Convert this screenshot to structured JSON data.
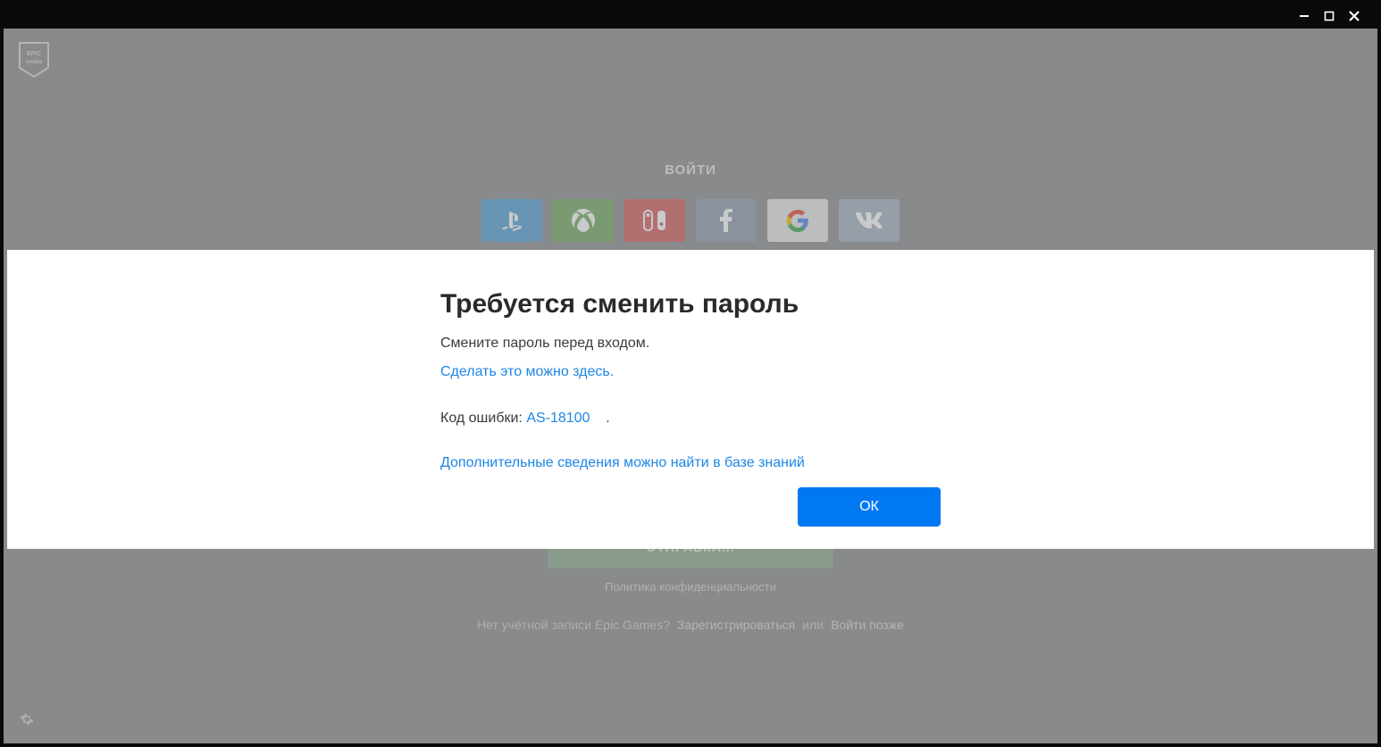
{
  "window": {
    "minimize": "−",
    "maximize": "☐",
    "close": "✕"
  },
  "login": {
    "title": "ВОЙТИ",
    "submit_label": "ОТПРАВКА...",
    "privacy_label": "Политика конфиденциальности",
    "no_account_label": "Нет учётной записи Epic Games?",
    "register_label": "Зарегистрироваться",
    "or_label": "или",
    "later_label": "Войти позже",
    "social": {
      "playstation": "PlayStation",
      "xbox": "Xbox",
      "nintendo": "Nintendo Switch",
      "facebook": "Facebook",
      "google": "Google",
      "vk": "VK"
    }
  },
  "modal": {
    "title": "Требуется сменить пароль",
    "message": "Смените пароль перед входом.",
    "do_here_link": "Сделать это можно здесь.",
    "error_label": "Код ошибки:",
    "error_code": "AS-18100",
    "error_suffix": ".",
    "kb_link": "Дополнительные сведения можно найти в базе знаний",
    "ok_label": "ОК"
  },
  "brand": {
    "logo_text": "EPIC GAMES"
  }
}
